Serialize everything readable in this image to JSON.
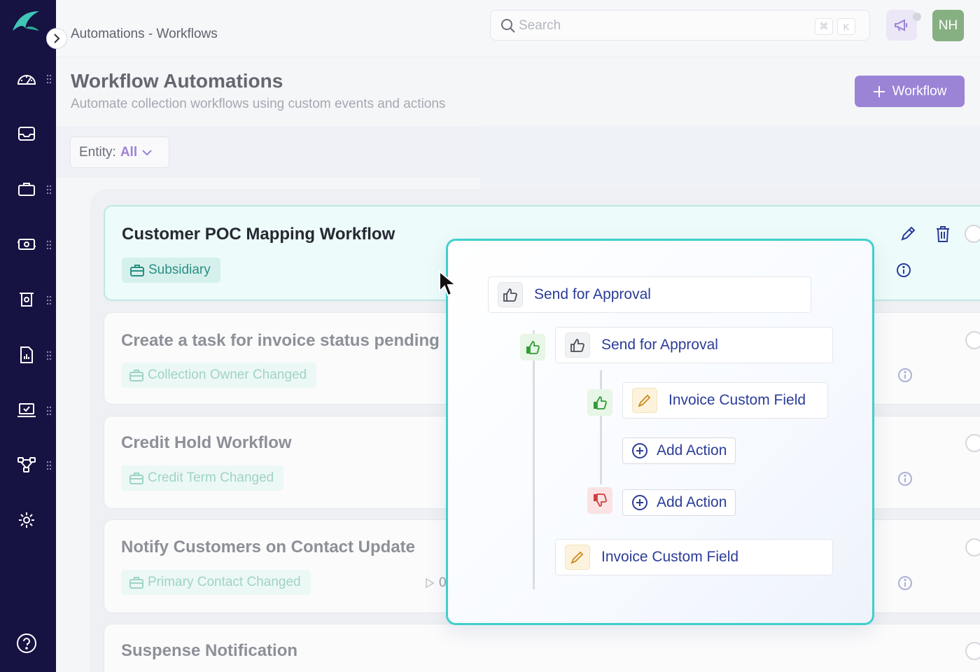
{
  "colors": {
    "sidebar_bg": "#161241",
    "accent": "#9b83d6",
    "teal": "#41cfca",
    "link_blue": "#2b3c98"
  },
  "sidebar": {
    "logo_icon": "fin-logo-icon",
    "items": [
      {
        "icon": "dashboard-gauge-icon"
      },
      {
        "icon": "inbox-icon"
      },
      {
        "icon": "briefcase-icon"
      },
      {
        "icon": "payments-cash-icon"
      },
      {
        "icon": "receipt-icon"
      },
      {
        "icon": "report-chart-icon"
      },
      {
        "icon": "laptop-check-icon"
      },
      {
        "icon": "workflow-nodes-icon"
      },
      {
        "icon": "settings-gear-icon"
      }
    ],
    "help_icon": "help-circle-icon"
  },
  "header": {
    "breadcrumb": "Automations - Workflows",
    "search": {
      "placeholder": "Search",
      "shortcut_keys": [
        "⌘",
        "K"
      ]
    },
    "avatar_initials": "NH"
  },
  "page": {
    "title": "Workflow Automations",
    "subtitle": "Automate collection workflows using custom events and actions",
    "add_button_label": "Workflow",
    "filter": {
      "label": "Entity:",
      "value": "All"
    }
  },
  "workflows": [
    {
      "name": "Customer POC Mapping Workflow",
      "tag": "Subsidiary",
      "active": true
    },
    {
      "name": "Create a task for invoice status pending",
      "tag": "Collection Owner Changed"
    },
    {
      "name": "Credit Hold Workflow",
      "tag": "Credit Term Changed"
    },
    {
      "name": "Notify Customers on Contact Update",
      "tag": "Primary Contact Changed",
      "run_count": "0"
    },
    {
      "name": "Suspense Notification"
    }
  ],
  "flow": {
    "root": "Send for Approval",
    "nested": "Send for Approval",
    "approved_action": "Invoice Custom Field",
    "add_action_1": "Add Action",
    "add_action_2": "Add Action",
    "final_action": "Invoice Custom Field"
  }
}
